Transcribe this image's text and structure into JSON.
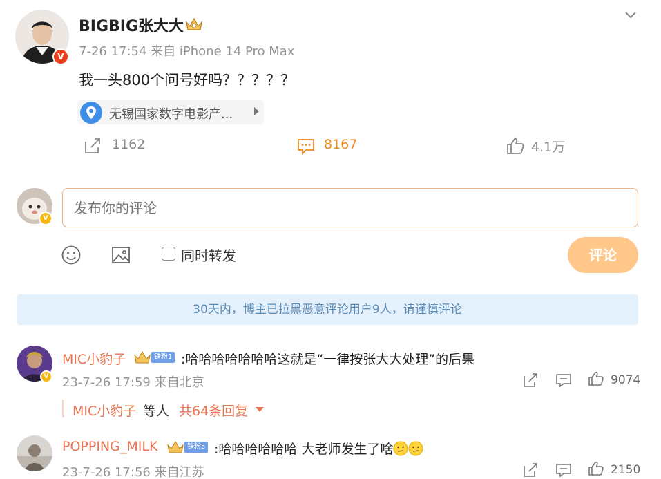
{
  "post": {
    "author": "BIGBIG张大大",
    "meta": "7-26 17:54  来自 iPhone 14 Pro Max",
    "text": "我一头800个问号好吗？？？？？",
    "location": "无锡国家数字电影产...",
    "reposts": "1162",
    "comments": "8167",
    "likes": "4.1万"
  },
  "composer": {
    "placeholder": "发布你的评论",
    "repost_label": "同时转发",
    "submit_label": "评论"
  },
  "notice": "30天内，博主已拉黑恶意评论用户9人，请谨慎评论",
  "comments": [
    {
      "name": "MIC小豹子",
      "fan_badge": "铁粉1",
      "text": ":哈哈哈哈哈哈哈这就是“一律按张大大处理”的后果",
      "meta": "23-7-26 17:59 来自北京",
      "likes": "9074",
      "reply_name": "MIC小豹子",
      "reply_mid": "等人",
      "reply_count": "共64条回复"
    },
    {
      "name": "POPPING_MILK",
      "fan_badge": "铁粉5",
      "text": ":哈哈哈哈哈哈 大老师发生了啥",
      "meta": "23-7-26 17:56 来自江苏",
      "likes": "2150"
    }
  ],
  "colors": {
    "accent": "#eb7350",
    "comment_count": "#f08a1c",
    "notice_bg": "#e4f0fb",
    "submit_bg": "#ffc88a"
  }
}
